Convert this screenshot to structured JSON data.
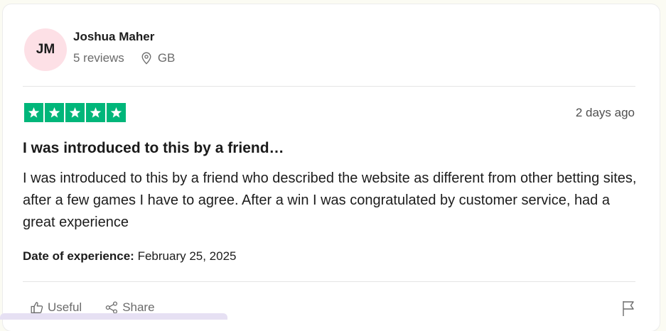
{
  "reviewer": {
    "initials": "JM",
    "name": "Joshua Maher",
    "reviews": "5 reviews",
    "country": "GB"
  },
  "review": {
    "rating": 5,
    "max_rating": 5,
    "date_ago": "2 days ago",
    "title": "I was introduced to this by a friend…",
    "body": "I was introduced to this by a friend who described the website as different from other betting sites, after a few games I have to agree. After a win I was congratulated by customer service, had a great experience",
    "experience_label": "Date of experience:",
    "experience_date": "February 25, 2025"
  },
  "actions": {
    "useful": "Useful",
    "share": "Share"
  },
  "colors": {
    "star": "#00b67a",
    "avatar_bg": "#fde0e6"
  },
  "icons": [
    "location-pin-icon",
    "star-icon",
    "thumbs-up-icon",
    "share-icon",
    "flag-icon"
  ]
}
